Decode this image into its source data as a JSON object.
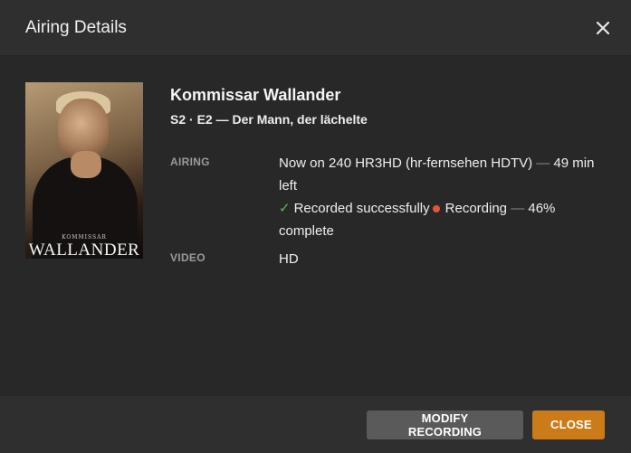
{
  "header": {
    "title": "Airing Details",
    "close_icon": "close-icon"
  },
  "poster": {
    "kommissar_text": "KOMMISSAR",
    "wallander_text": "WALLANDER"
  },
  "details": {
    "show_title": "Kommissar Wallander",
    "episode": "S2 · E2 — Der Mann, der lächelte",
    "airing_label": "AIRING",
    "airing_now": "Now on 240 HR3HD (hr-fernsehen HDTV)",
    "airing_dash": "—",
    "airing_remaining": "49 min left",
    "recorded_text": "Recorded successfully",
    "recording_text": "Recording",
    "recording_dash": "—",
    "recording_progress": "46% complete",
    "video_label": "VIDEO",
    "video_value": "HD",
    "colors": {
      "check": "#5cb85c",
      "recording_dot": "#e5533d"
    }
  },
  "footer": {
    "modify_label": "MODIFY RECORDING",
    "close_label": "CLOSE",
    "colors": {
      "modify_bg": "#5a5a5a",
      "close_bg": "#cc7b19"
    }
  }
}
